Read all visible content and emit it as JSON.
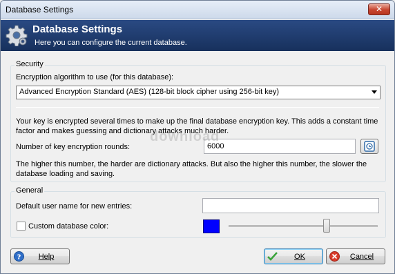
{
  "window": {
    "title": "Database Settings",
    "close_glyph": "✕"
  },
  "banner": {
    "icon": "gear-icon",
    "title": "Database Settings",
    "subtitle": "Here you can configure the current database."
  },
  "security": {
    "group_label": "Security",
    "algorithm_label": "Encryption algorithm to use (for this database):",
    "algorithm_value": "Advanced Encryption Standard (AES) (128-bit block cipher using 256-bit key)",
    "key_info": "Your key is encrypted several times to make up the final database encryption key. This adds a constant time factor and makes guessing and dictionary attacks much harder.",
    "rounds_label": "Number of key encryption rounds:",
    "rounds_value": "6000",
    "rounds_note": "The higher this number, the harder are dictionary attacks. But also the higher this number, the slower the database loading and saving."
  },
  "general": {
    "group_label": "General",
    "username_label": "Default user name for new entries:",
    "username_value": "",
    "color_label": "Custom database color:",
    "color_checked": false,
    "color_hex": "#0000ff"
  },
  "buttons": {
    "help": "Help",
    "ok": "OK",
    "cancel": "Cancel"
  },
  "watermark": "download"
}
